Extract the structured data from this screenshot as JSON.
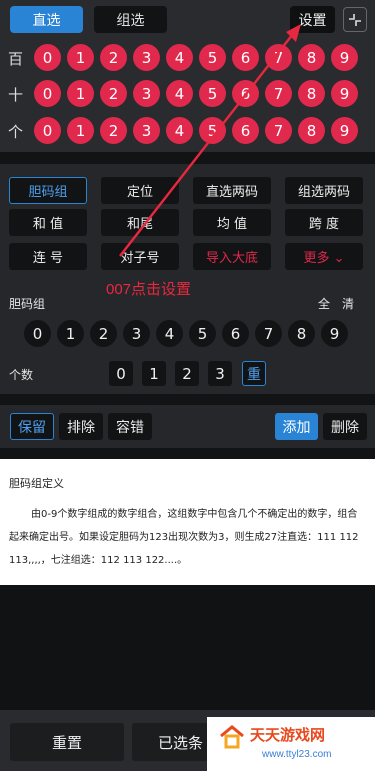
{
  "modes": {
    "direct": "直选",
    "group": "组选"
  },
  "settings_label": "设置",
  "digit_rows": [
    {
      "label": "百",
      "digits": [
        "0",
        "1",
        "2",
        "3",
        "4",
        "5",
        "6",
        "7",
        "8",
        "9"
      ]
    },
    {
      "label": "十",
      "digits": [
        "0",
        "1",
        "2",
        "3",
        "4",
        "5",
        "6",
        "7",
        "8",
        "9"
      ]
    },
    {
      "label": "个",
      "digits": [
        "0",
        "1",
        "2",
        "3",
        "4",
        "5",
        "6",
        "7",
        "8",
        "9"
      ]
    }
  ],
  "play_types": [
    [
      "胆码组",
      "定位",
      "直选两码",
      "组选两码"
    ],
    [
      "和 值",
      "和尾",
      "均 值",
      "跨 度"
    ],
    [
      "连 号",
      "对子号",
      "导入大底",
      "更多 ⌄"
    ]
  ],
  "annotation": "007点击设置",
  "dan": {
    "title": "胆码组",
    "clear": "全清",
    "digits": [
      "0",
      "1",
      "2",
      "3",
      "4",
      "5",
      "6",
      "7",
      "8",
      "9"
    ],
    "count_label": "个数",
    "counts": [
      "0",
      "1",
      "2",
      "3",
      "重"
    ]
  },
  "actions": {
    "keep": "保留",
    "exclude": "排除",
    "tolerance": "容错",
    "add": "添加",
    "delete": "删除"
  },
  "description": {
    "title": "胆码组定义",
    "body": "由0-9个数字组成的数字组合，这组数字中包含几个不确定出的数字，组合起来确定出号。如果设定胆码为123出现次数为3，则生成27注直选：111 112 113,,,,，七注组选：112 113 122....。"
  },
  "bottom": {
    "reset": "重置",
    "selected": "已选条"
  },
  "watermark": {
    "name": "天天游戏网",
    "url": "www.ttyl23.com"
  },
  "colors": {
    "accent": "#2a84d6",
    "ball_red": "#e0294d",
    "annotation_red": "#e8283f"
  }
}
